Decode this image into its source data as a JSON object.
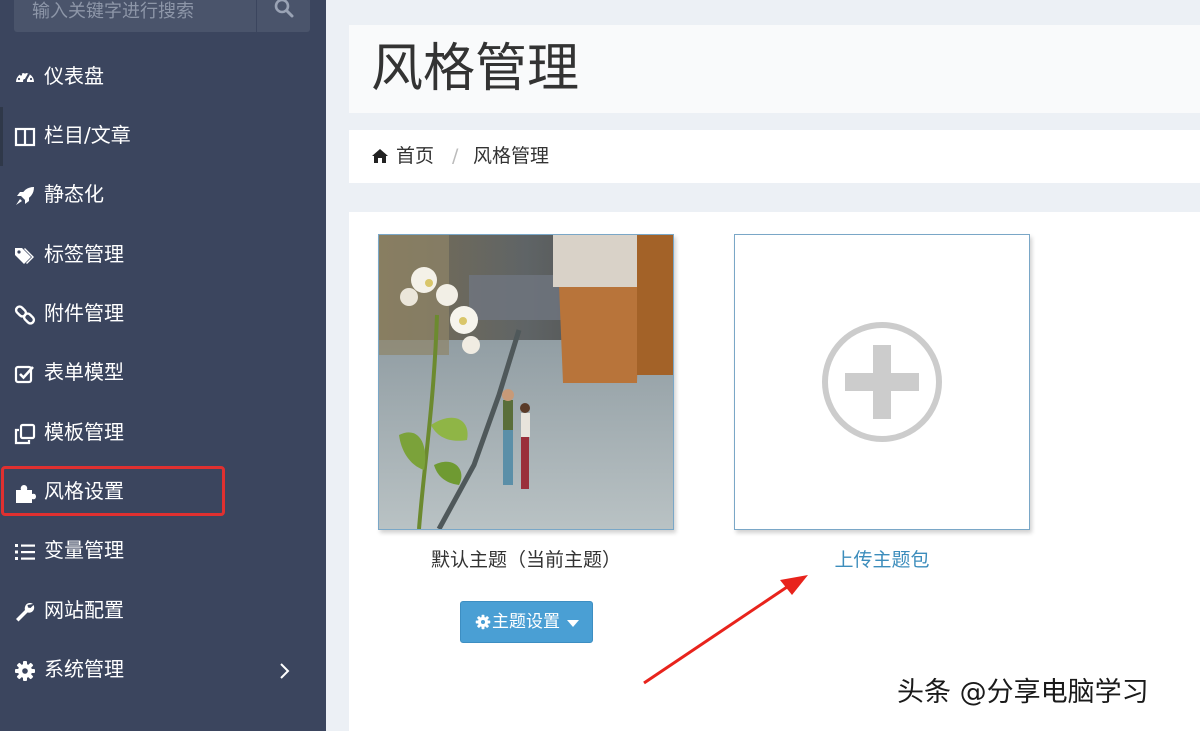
{
  "sidebar": {
    "search": {
      "placeholder": "输入关键字进行搜索"
    },
    "items": [
      {
        "label": "仪表盘",
        "icon": "dashboard-icon"
      },
      {
        "label": "栏目/文章",
        "icon": "columns-icon"
      },
      {
        "label": "静态化",
        "icon": "rocket-icon"
      },
      {
        "label": "标签管理",
        "icon": "tags-icon"
      },
      {
        "label": "附件管理",
        "icon": "link-icon"
      },
      {
        "label": "表单模型",
        "icon": "check-square-icon"
      },
      {
        "label": "模板管理",
        "icon": "clone-icon"
      },
      {
        "label": "风格设置",
        "icon": "puzzle-icon"
      },
      {
        "label": "变量管理",
        "icon": "list-icon"
      },
      {
        "label": "网站配置",
        "icon": "wrench-icon"
      },
      {
        "label": "系统管理",
        "icon": "gear-icon"
      }
    ]
  },
  "header": {
    "title": "风格管理"
  },
  "breadcrumb": {
    "home": "首页",
    "separator": "/",
    "current": "风格管理"
  },
  "themes": {
    "default_name": "默认主题（当前主题）",
    "settings_button": "主题设置",
    "upload_label": "上传主题包"
  },
  "watermark": "头条 @分享电脑学习",
  "colors": {
    "sidebar_bg": "#3b455e",
    "accent_blue": "#4a9fd4",
    "link_blue": "#3c8dbc",
    "highlight_red": "#e03030"
  }
}
